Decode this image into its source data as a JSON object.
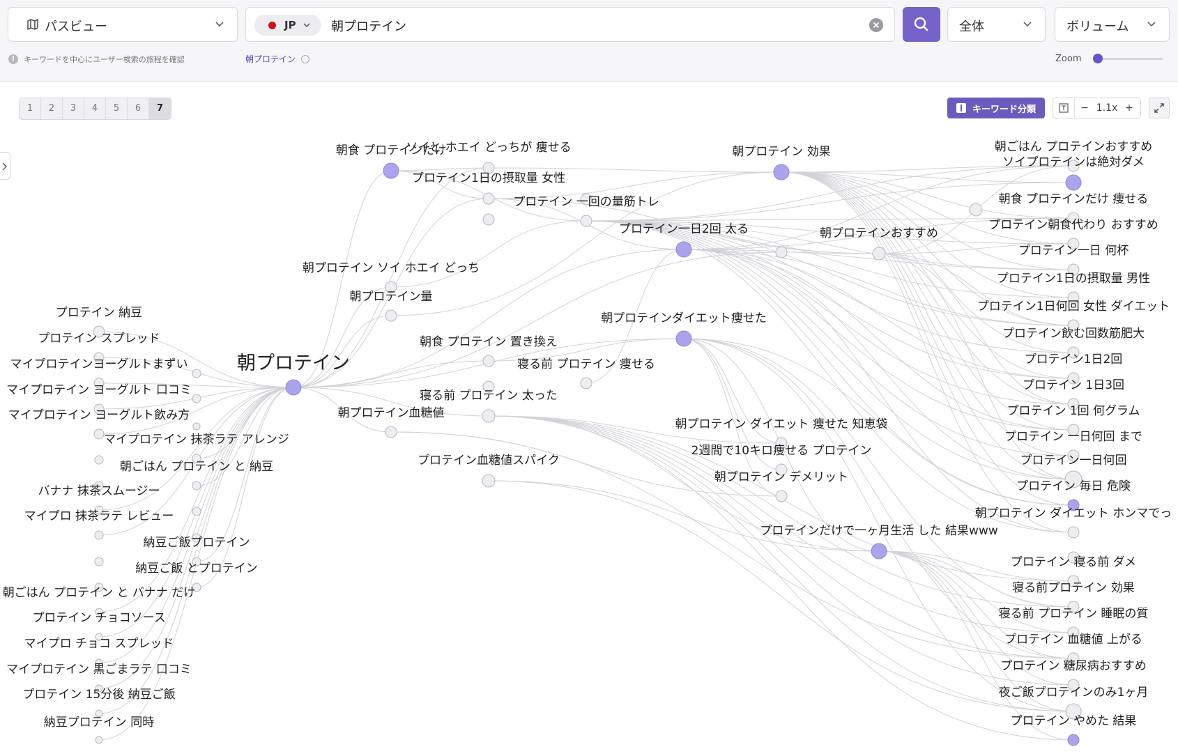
{
  "toolbar": {
    "view_select": "パスビュー",
    "country": "JP",
    "search_query": "朝プロテイン",
    "scope_select": "全体",
    "sort_select": "ボリューム",
    "hint": "キーワードを中心にユーザー検索の旅程を確認",
    "active_chip": "朝プロテイン",
    "zoom_label": "Zoom",
    "zoom_slider_fraction": 0.02
  },
  "controls": {
    "pages": [
      "1",
      "2",
      "3",
      "4",
      "5",
      "6",
      "7"
    ],
    "active_page": "7",
    "keyword_classify_label": "キーワード分類",
    "zoom_value": "1.1x",
    "zoom_minus": "−",
    "zoom_plus": "+"
  },
  "colors": {
    "accent": "#7462c9",
    "node_highlight": "#aba4ec",
    "node_default": "#eeeef2",
    "edge": "#d2d2d8"
  },
  "graph": {
    "root": "朝プロテイン",
    "nodes": [
      {
        "id": "n1",
        "label": "朝プロテイン",
        "hl": true
      },
      {
        "id": "a1",
        "label": "朝食 プロテインだけ",
        "hl": true
      },
      {
        "id": "a2",
        "label": "ソイと ホエイ どっちが 痩せる",
        "hl": false
      },
      {
        "id": "a3",
        "label": "プロテイン1日の摂取量 女性",
        "hl": false
      },
      {
        "id": "a4",
        "label": "プロテイン 一回の量筋トレ",
        "hl": false
      },
      {
        "id": "a5",
        "label": "朝プロテイン 効果",
        "hl": true
      },
      {
        "id": "a6",
        "label": "プロテイン一日2回 太る",
        "hl": true
      },
      {
        "id": "a7",
        "label": "朝プロテインおすすめ",
        "hl": false
      },
      {
        "id": "a8",
        "label": "朝プロテイン ソイ ホエイ どっち",
        "hl": false
      },
      {
        "id": "a9",
        "label": "朝プロテイン量",
        "hl": false
      },
      {
        "id": "a10",
        "label": "朝プロテインダイエット痩せた",
        "hl": true
      },
      {
        "id": "a11",
        "label": "朝食 プロテイン 置き換え",
        "hl": false
      },
      {
        "id": "a12",
        "label": "寝る前 プロテイン 痩せる",
        "hl": false
      },
      {
        "id": "a13",
        "label": "寝る前 プロテイン 太った",
        "hl": false
      },
      {
        "id": "a14",
        "label": "朝プロテイン血糖値",
        "hl": false
      },
      {
        "id": "a15",
        "label": "プロテイン血糖値スパイク",
        "hl": false
      },
      {
        "id": "a16",
        "label": "朝プロテイン ダイエット 痩せた 知恵袋",
        "hl": false
      },
      {
        "id": "a17",
        "label": "2週間で10キロ痩せる プロテイン",
        "hl": false
      },
      {
        "id": "a18",
        "label": "朝プロテイン デメリット",
        "hl": false
      },
      {
        "id": "a19",
        "label": "プロテインだけで一ヶ月生活 した 結果www",
        "hl": true
      },
      {
        "id": "l1",
        "label": "プロテイン 納豆",
        "hl": false
      },
      {
        "id": "l2",
        "label": "プロテイン スプレッド",
        "hl": false
      },
      {
        "id": "l3",
        "label": "マイプロテインヨーグルトまずい",
        "hl": false
      },
      {
        "id": "l4",
        "label": "マイプロテイン ヨーグルト 口コミ",
        "hl": false
      },
      {
        "id": "l5",
        "label": "マイプロテイン ヨーグルト飲み方",
        "hl": false
      },
      {
        "id": "l6",
        "label": "マイプロテイン 抹茶ラテ アレンジ",
        "hl": false
      },
      {
        "id": "l7",
        "label": "朝ごはん プロテイン と 納豆",
        "hl": false
      },
      {
        "id": "l8",
        "label": "バナナ 抹茶スムージー",
        "hl": false
      },
      {
        "id": "l9",
        "label": "マイプロ 抹茶ラテ レビュー",
        "hl": false
      },
      {
        "id": "l10",
        "label": "納豆ご飯プロテイン",
        "hl": false
      },
      {
        "id": "l11",
        "label": "納豆ご飯 とプロテイン",
        "hl": false
      },
      {
        "id": "l12",
        "label": "朝ごはん プロテイン と バナナ だけ",
        "hl": false
      },
      {
        "id": "l13",
        "label": "プロテイン チョコソース",
        "hl": false
      },
      {
        "id": "l14",
        "label": "マイプロ チョコ スプレッド",
        "hl": false
      },
      {
        "id": "l15",
        "label": "マイプロテイン 黒ごまラテ 口コミ",
        "hl": false
      },
      {
        "id": "l16",
        "label": "プロテイン 15分後 納豆ご飯",
        "hl": false
      },
      {
        "id": "l17",
        "label": "納豆プロテイン 同時",
        "hl": false
      },
      {
        "id": "r1",
        "label": "朝ごはん プロテインおすすめ",
        "hl": false
      },
      {
        "id": "r2",
        "label": "ソイプロテインは絶対ダメ",
        "hl": true
      },
      {
        "id": "r3",
        "label": "朝食 プロテインだけ 痩せる",
        "hl": false
      },
      {
        "id": "r4",
        "label": "プロテイン朝食代わり おすすめ",
        "hl": false
      },
      {
        "id": "r5",
        "label": "プロテイン一日 何杯",
        "hl": false
      },
      {
        "id": "r6",
        "label": "プロテイン1日の摂取量 男性",
        "hl": false
      },
      {
        "id": "r7",
        "label": "プロテイン1日何回 女性 ダイエット",
        "hl": false
      },
      {
        "id": "r8",
        "label": "プロテイン飲む回数筋肥大",
        "hl": false
      },
      {
        "id": "r9",
        "label": "プロテイン1日2回",
        "hl": false
      },
      {
        "id": "r10",
        "label": "プロテイン 1日3回",
        "hl": false
      },
      {
        "id": "r11",
        "label": "プロテイン 1回 何グラム",
        "hl": false
      },
      {
        "id": "r12",
        "label": "プロテイン 一日何回 まで",
        "hl": false
      },
      {
        "id": "r13",
        "label": "プロテイン一日何回",
        "hl": false
      },
      {
        "id": "r14",
        "label": "プロテイン 毎日 危険",
        "hl": true
      },
      {
        "id": "r15",
        "label": "朝プロテイン ダイエット ホンマでっ",
        "hl": false
      },
      {
        "id": "r16",
        "label": "プロテイン 寝る前 ダメ",
        "hl": false
      },
      {
        "id": "r17",
        "label": "寝る前プロテイン 効果",
        "hl": false
      },
      {
        "id": "r18",
        "label": "寝る前 プロテイン 睡眠の質",
        "hl": false
      },
      {
        "id": "r19",
        "label": "プロテイン 血糖値 上がる",
        "hl": false
      },
      {
        "id": "r20",
        "label": "プロテイン 糖尿病おすすめ",
        "hl": false
      },
      {
        "id": "r21",
        "label": "夜ご飯プロテインのみ1ヶ月",
        "hl": false
      },
      {
        "id": "r22",
        "label": "プロテイン やめた 結果",
        "hl": true
      }
    ]
  }
}
